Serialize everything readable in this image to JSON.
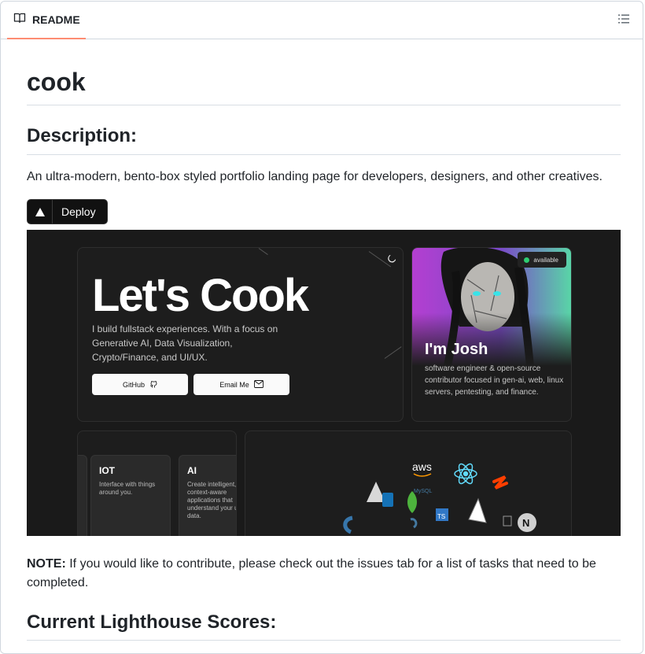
{
  "tab": {
    "label": "README",
    "icon": "book-icon"
  },
  "toc_icon": "list-icon",
  "readme": {
    "title": "cook",
    "description_heading": "Description:",
    "description": "An ultra-modern, bento-box styled portfolio landing page for developers, designers, and other creatives.",
    "deploy_label": "Deploy",
    "note_label": "NOTE:",
    "note_text": " If you would like to contribute, please check out the issues tab for a list of tasks that need to be completed.",
    "scores_heading": "Current Lighthouse Scores:"
  },
  "screenshot": {
    "hero_title": "Let's Cook",
    "hero_text": "I build fullstack experiences. With a focus on Generative AI, Data Visualization, Crypto/Finance, and UI/UX.",
    "github_label": "GitHub",
    "email_label": "Email Me",
    "status_badge": "available",
    "profile_name": "I'm Josh",
    "profile_text": "software engineer & open-source contributor focused in gen-ai, web, linux servers, pentesting, and finance.",
    "services": [
      {
        "title": "IOT",
        "text": "Interface with things around you."
      },
      {
        "title": "AI",
        "text": "Create intelligent, context-aware applications that understand your unique data."
      }
    ],
    "tech_logos": [
      "aws",
      "MySQL",
      "TS"
    ]
  }
}
